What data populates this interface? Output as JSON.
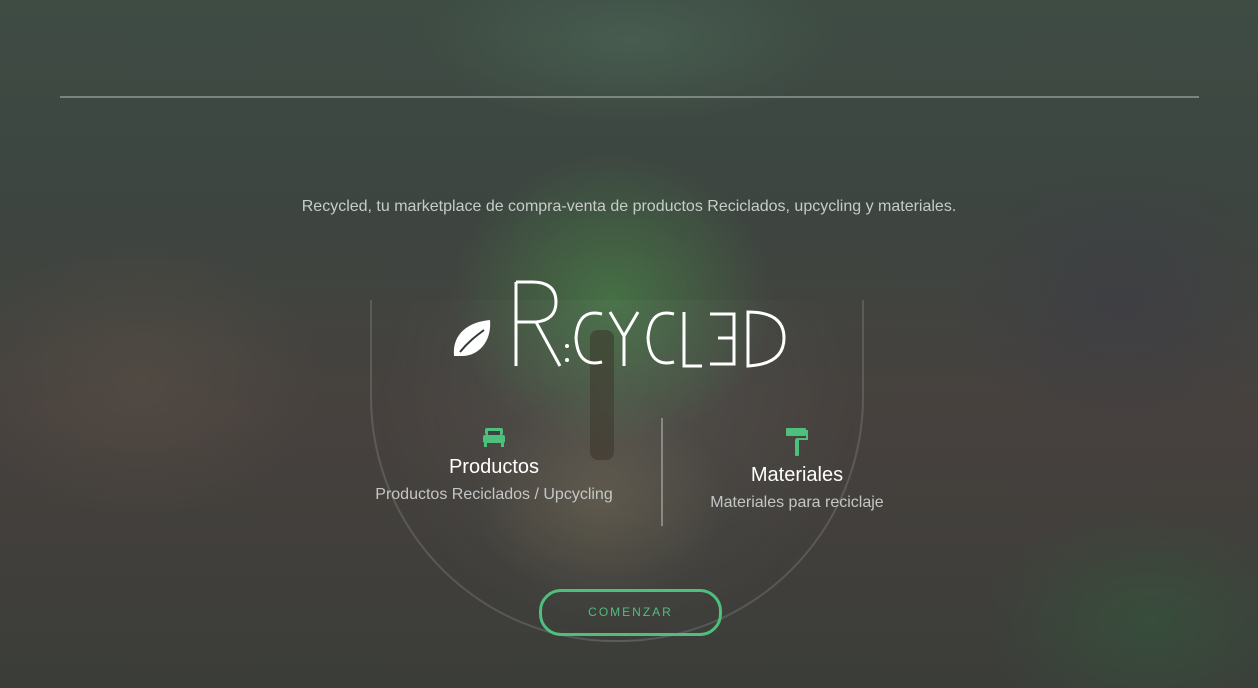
{
  "hero": {
    "tagline": "Recycled, tu marketplace de compra-venta de productos Reciclados, upcycling y materiales.",
    "logo_text": "RECYCLED"
  },
  "features": [
    {
      "icon": "bed-icon",
      "title": "Productos",
      "subtitle": "Productos Reciclados / Upcycling"
    },
    {
      "icon": "paint-roller-icon",
      "title": "Materiales",
      "subtitle": "Materiales para reciclaje"
    }
  ],
  "cta": {
    "label": "COMENZAR"
  },
  "colors": {
    "accent": "#4fbf7e",
    "text": "#ffffff",
    "muted": "#c4c7c6"
  }
}
